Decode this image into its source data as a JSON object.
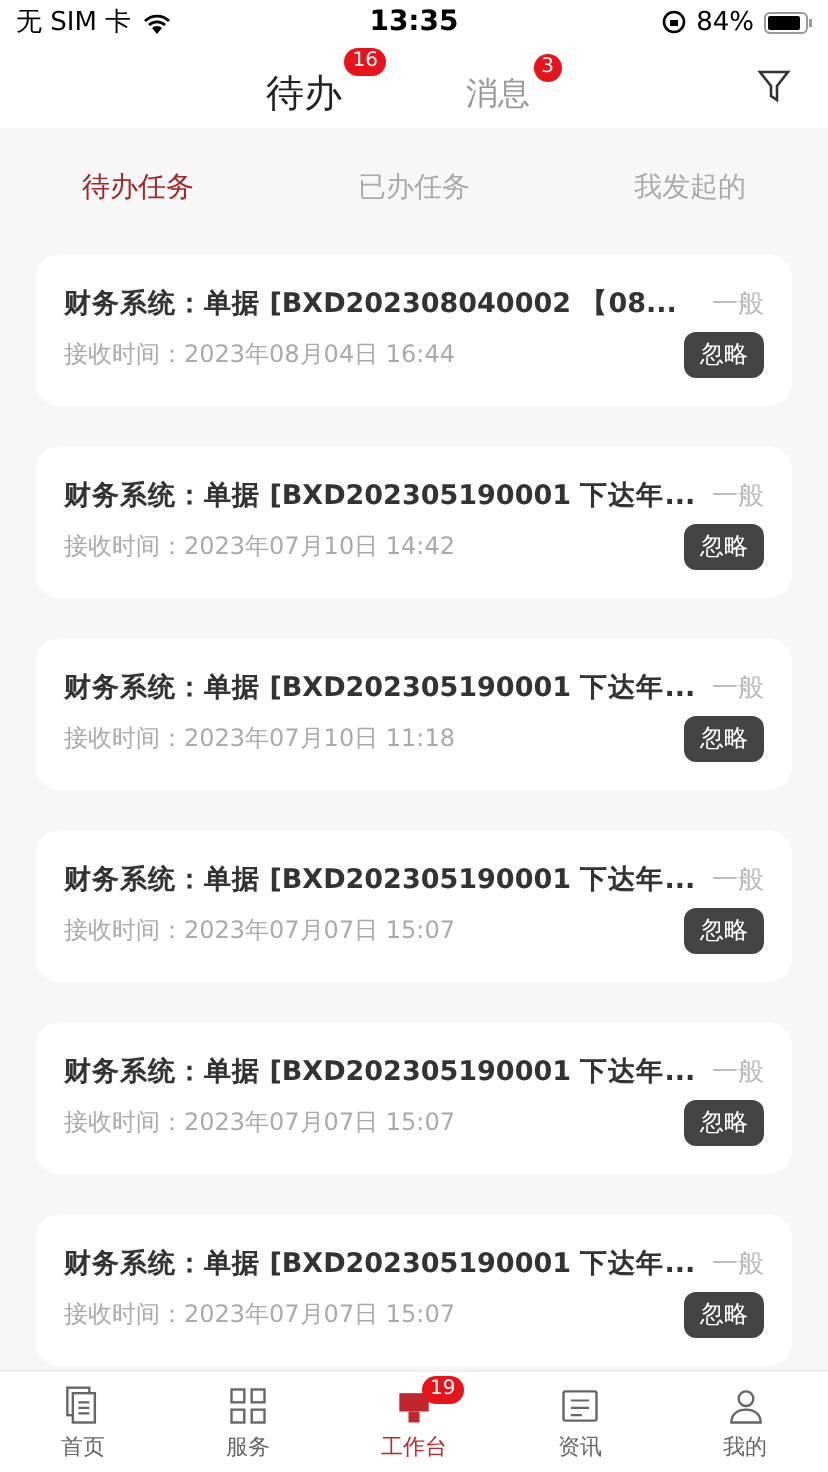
{
  "status_bar": {
    "carrier": "无 SIM 卡",
    "time": "13:35",
    "battery": "84%"
  },
  "header_tabs": [
    {
      "label": "待办",
      "badge": "16",
      "selected": true
    },
    {
      "label": "消息",
      "badge": "3",
      "selected": false
    }
  ],
  "sub_tabs": [
    {
      "label": "待办任务",
      "selected": true
    },
    {
      "label": "已办任务",
      "selected": false
    },
    {
      "label": "我发起的",
      "selected": false
    }
  ],
  "tasks": [
    {
      "title": "财务系统：单据 [BXD202308040002 【08...",
      "priority": "一般",
      "time": "接收时间：2023年08月04日 16:44",
      "action": "忽略"
    },
    {
      "title": "财务系统：单据 [BXD202305190001 下达年...",
      "priority": "一般",
      "time": "接收时间：2023年07月10日 14:42",
      "action": "忽略"
    },
    {
      "title": "财务系统：单据 [BXD202305190001 下达年...",
      "priority": "一般",
      "time": "接收时间：2023年07月10日 11:18",
      "action": "忽略"
    },
    {
      "title": "财务系统：单据 [BXD202305190001 下达年...",
      "priority": "一般",
      "time": "接收时间：2023年07月07日 15:07",
      "action": "忽略"
    },
    {
      "title": "财务系统：单据 [BXD202305190001 下达年...",
      "priority": "一般",
      "time": "接收时间：2023年07月07日 15:07",
      "action": "忽略"
    },
    {
      "title": "财务系统：单据 [BXD202305190001 下达年...",
      "priority": "一般",
      "time": "接收时间：2023年07月07日 15:07",
      "action": "忽略"
    }
  ],
  "tab_bar": [
    {
      "kind": "home",
      "label": "首页",
      "selected": false
    },
    {
      "kind": "grid",
      "label": "服务",
      "selected": false
    },
    {
      "kind": "desk",
      "label": "工作台",
      "badge": "19",
      "selected": true
    },
    {
      "kind": "news",
      "label": "资讯",
      "selected": false
    },
    {
      "kind": "user",
      "label": "我的",
      "selected": false
    }
  ]
}
